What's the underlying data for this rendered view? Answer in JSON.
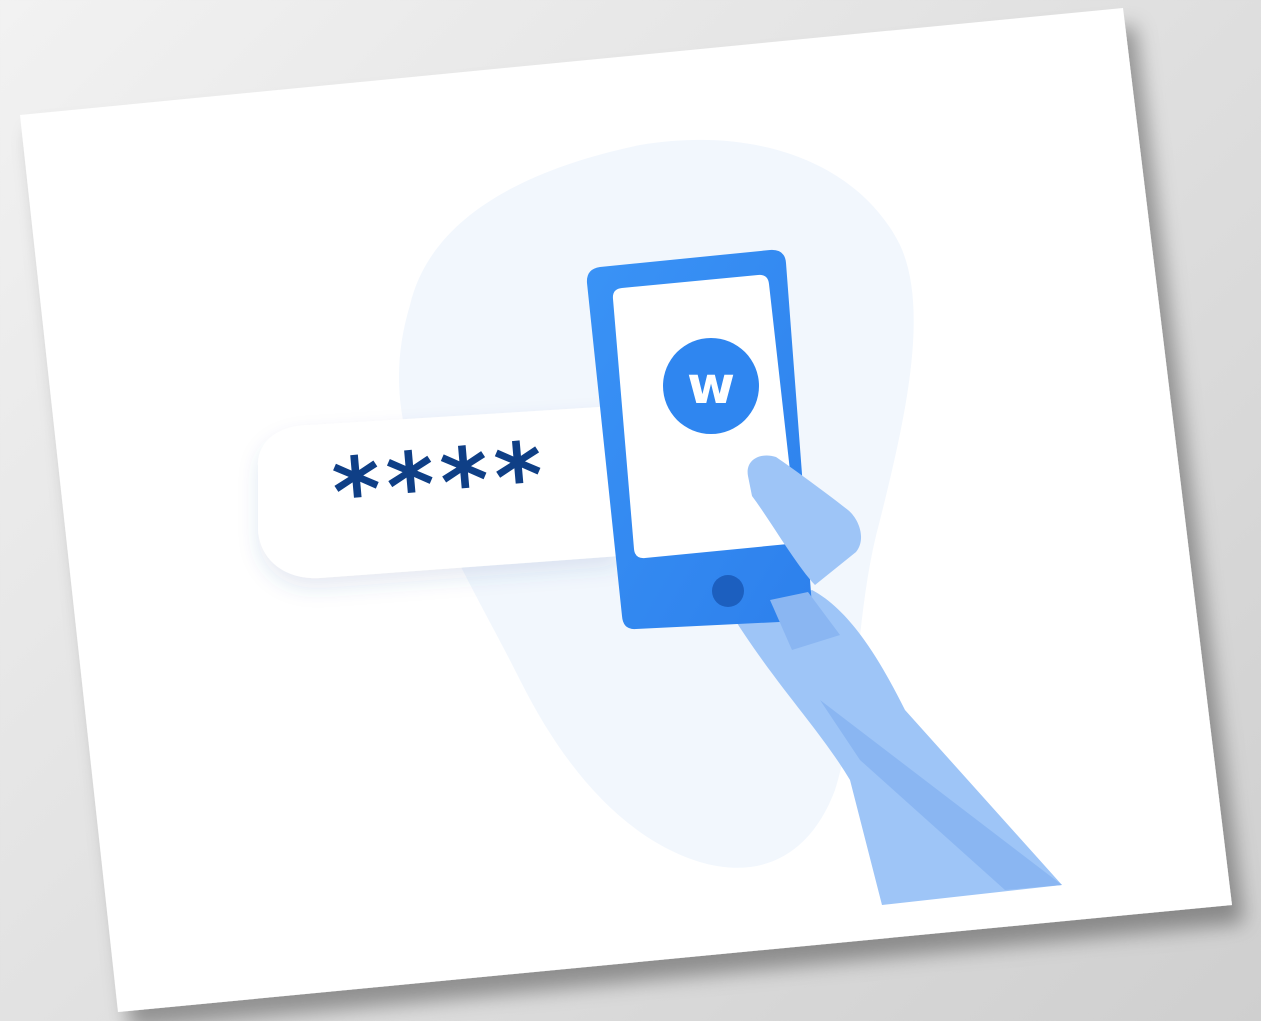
{
  "image": {
    "description_hidden": false
  },
  "password_field": {
    "mask": "****"
  },
  "phone": {
    "app_logo_letter": "w"
  },
  "colors": {
    "phone_blue": "#2f86f0",
    "phone_blue_dark": "#1f6fd6",
    "screen_white": "#ffffff",
    "mask_navy": "#0f3f86",
    "hand_light": "#9ec5f7",
    "hand_dark": "#8ab6f2",
    "blob_bg": "#f2f7fd"
  }
}
